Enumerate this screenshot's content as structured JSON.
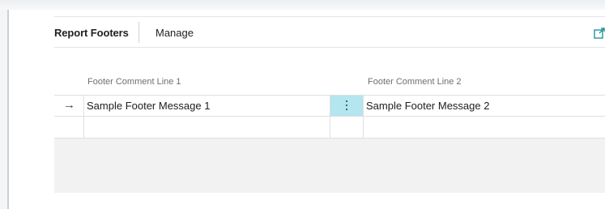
{
  "tabs": {
    "report_footers": "Report Footers",
    "manage": "Manage"
  },
  "icons": {
    "expand": "expand-icon",
    "row_indicator": "arrow-right-icon",
    "row_menu": "more-vertical-icon"
  },
  "table": {
    "columns": [
      "Footer Comment Line 1",
      "Footer Comment Line 2"
    ],
    "rows": [
      {
        "current": true,
        "line1": "Sample Footer Message 1",
        "line2": "Sample Footer Message 2"
      },
      {
        "current": false,
        "line1": "",
        "line2": ""
      }
    ]
  },
  "colors": {
    "selected_cell": "#b3e6ee",
    "accent": "#00838f",
    "empty_area": "#f2f2f2"
  }
}
